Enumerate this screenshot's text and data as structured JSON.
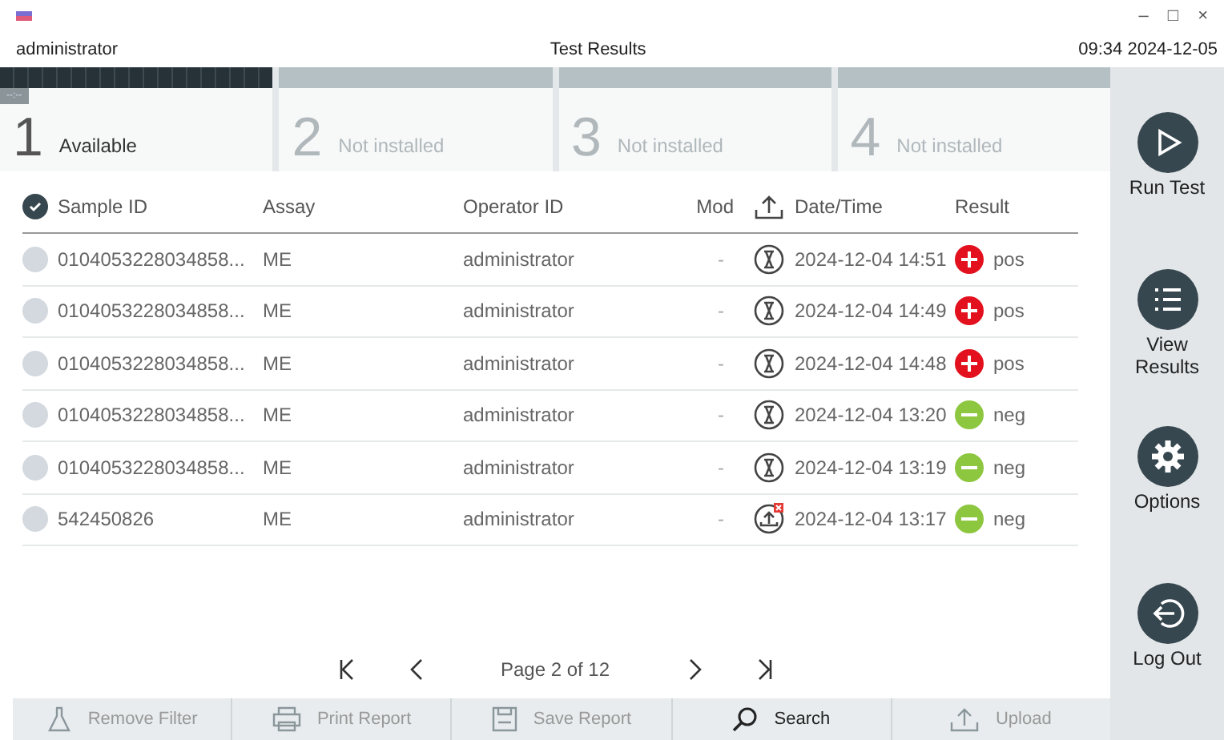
{
  "window": {
    "user": "administrator",
    "title": "Test Results",
    "clock": "09:34 2024-12-05",
    "controls": [
      "–",
      "□",
      "×"
    ]
  },
  "modules": [
    {
      "number": "1",
      "status": "Available",
      "installed": true,
      "timer": "--:--"
    },
    {
      "number": "2",
      "status": "Not installed",
      "installed": false
    },
    {
      "number": "3",
      "status": "Not installed",
      "installed": false
    },
    {
      "number": "4",
      "status": "Not installed",
      "installed": false
    }
  ],
  "table": {
    "select_all_checked": true,
    "columns": [
      "Sample ID",
      "Assay",
      "Operator ID",
      "Mod",
      "Date/Time",
      "Result"
    ],
    "rows": [
      {
        "checked": false,
        "sample_id": "0104053228034858...",
        "assay": "ME",
        "operator": "administrator",
        "mod": "-",
        "upload_failed": false,
        "datetime": "2024-12-04 14:51",
        "positive": true,
        "result": "pos"
      },
      {
        "checked": false,
        "sample_id": "0104053228034858...",
        "assay": "ME",
        "operator": "administrator",
        "mod": "-",
        "upload_failed": false,
        "datetime": "2024-12-04 14:49",
        "positive": true,
        "result": "pos"
      },
      {
        "checked": false,
        "sample_id": "0104053228034858...",
        "assay": "ME",
        "operator": "administrator",
        "mod": "-",
        "upload_failed": false,
        "datetime": "2024-12-04 14:48",
        "positive": true,
        "result": "pos"
      },
      {
        "checked": false,
        "sample_id": "0104053228034858...",
        "assay": "ME",
        "operator": "administrator",
        "mod": "-",
        "upload_failed": false,
        "datetime": "2024-12-04 13:20",
        "positive": false,
        "result": "neg"
      },
      {
        "checked": false,
        "sample_id": "0104053228034858...",
        "assay": "ME",
        "operator": "administrator",
        "mod": "-",
        "upload_failed": false,
        "datetime": "2024-12-04 13:19",
        "positive": false,
        "result": "neg"
      },
      {
        "checked": false,
        "sample_id": "542450826",
        "assay": "ME",
        "operator": "administrator",
        "mod": "-",
        "upload_failed": true,
        "datetime": "2024-12-04 13:17",
        "positive": false,
        "result": "neg"
      }
    ]
  },
  "pagination": {
    "label": "Page 2 of 12"
  },
  "toolbar": [
    {
      "kind": "filter",
      "label": "Remove Filter",
      "disabled": true
    },
    {
      "kind": "print",
      "label": "Print Report",
      "disabled": true
    },
    {
      "kind": "save",
      "label": "Save Report",
      "disabled": true
    },
    {
      "kind": "search",
      "label": "Search",
      "disabled": false
    },
    {
      "kind": "upload",
      "label": "Upload",
      "disabled": true
    }
  ],
  "sidebar": [
    {
      "kind": "run",
      "label": "Run Test"
    },
    {
      "kind": "results",
      "label": "View Results"
    },
    {
      "kind": "options",
      "label": "Options"
    },
    {
      "kind": "logout",
      "label": "Log Out"
    }
  ]
}
